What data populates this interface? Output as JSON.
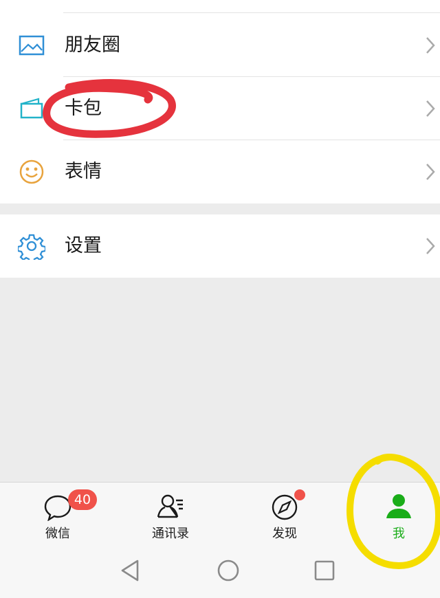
{
  "menu": {
    "items": [
      {
        "label": "朋友圈",
        "icon": "moments-image-icon"
      },
      {
        "label": "卡包",
        "icon": "card-wallet-icon"
      },
      {
        "label": "表情",
        "icon": "smiley-face-icon"
      },
      {
        "label": "设置",
        "icon": "gear-icon"
      }
    ]
  },
  "tabbar": {
    "tabs": [
      {
        "label": "微信",
        "icon": "chat-bubble-icon",
        "badge": "40"
      },
      {
        "label": "通讯录",
        "icon": "contacts-icon"
      },
      {
        "label": "发现",
        "icon": "compass-icon",
        "has_dot": true
      },
      {
        "label": "我",
        "icon": "person-icon",
        "active": true
      }
    ]
  },
  "colors": {
    "accent_green": "#1aad19",
    "badge_red": "#f0524a",
    "annotation_red": "#e5333d",
    "annotation_yellow": "#f5dd00",
    "icon_blue": "#2f8fd6",
    "icon_orange": "#e8a33d"
  },
  "nav": {
    "buttons": [
      "back-triangle-icon",
      "home-circle-icon",
      "recents-square-icon"
    ]
  }
}
